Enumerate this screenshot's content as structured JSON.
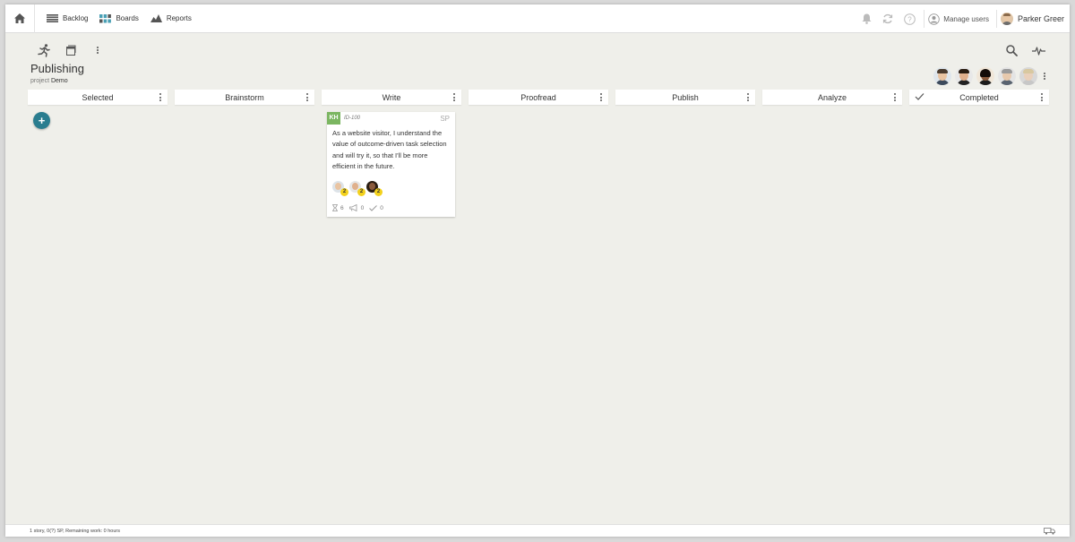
{
  "nav": {
    "items": [
      {
        "label": "Backlog",
        "icon": "list-icon"
      },
      {
        "label": "Boards",
        "icon": "board-icon"
      },
      {
        "label": "Reports",
        "icon": "chart-icon"
      }
    ],
    "manage_users": "Manage users",
    "user_name": "Parker Greer"
  },
  "board": {
    "title": "Publishing",
    "project_prefix": "project",
    "project_name": "Demo"
  },
  "columns": [
    {
      "label": "Selected"
    },
    {
      "label": "Brainstorm"
    },
    {
      "label": "Write"
    },
    {
      "label": "Proofread"
    },
    {
      "label": "Publish"
    },
    {
      "label": "Analyze"
    },
    {
      "label": "Completed",
      "done": true
    }
  ],
  "add_button": "+",
  "card": {
    "tag": "KH",
    "tag_color": "#7bb661",
    "id": "ID-100",
    "points": "SP",
    "description": "As a website visitor, I understand the value of outcome-driven task selection and will try it, so that I'll be more efficient in the future.",
    "assignees": [
      {
        "badge": "2"
      },
      {
        "badge": "2"
      },
      {
        "badge": "2"
      }
    ],
    "stats": {
      "tasks": "6",
      "comments": "0",
      "done": "0"
    }
  },
  "status": {
    "text": "1 story, 0(?) SP, Remaining work: 0 hours"
  },
  "colors": {
    "accent": "#2a7d8f",
    "badge": "#f3d11c",
    "background": "#efefea"
  }
}
